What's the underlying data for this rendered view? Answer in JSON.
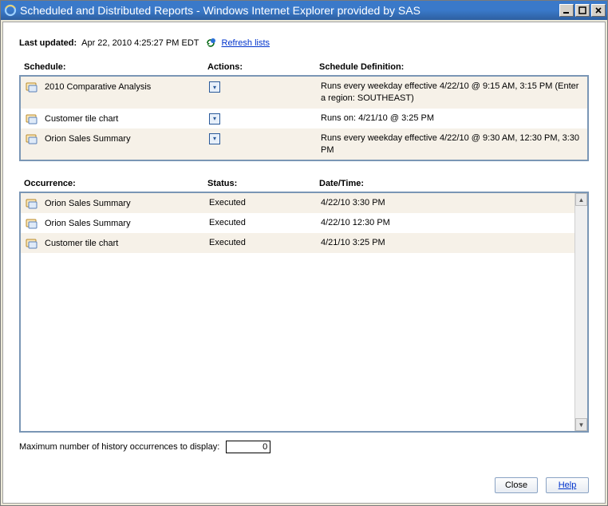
{
  "window": {
    "title": "Scheduled and Distributed Reports - Windows Internet Explorer provided by SAS"
  },
  "lastUpdated": {
    "label": "Last updated:",
    "value": "Apr 22, 2010 4:25:27 PM EDT",
    "refreshLabel": " Refresh lists"
  },
  "scheduleHeaders": {
    "schedule": "Schedule:",
    "actions": "Actions:",
    "definition": "Schedule Definition:"
  },
  "schedules": [
    {
      "name": "2010 Comparative Analysis",
      "definition": "Runs every weekday effective 4/22/10 @ 9:15 AM, 3:15 PM (Enter a region: SOUTHEAST)"
    },
    {
      "name": "Customer tile chart",
      "definition": "Runs on: 4/21/10 @ 3:25 PM"
    },
    {
      "name": "Orion Sales Summary",
      "definition": "Runs every weekday effective 4/22/10 @ 9:30 AM, 12:30 PM, 3:30 PM"
    }
  ],
  "occurrenceHeaders": {
    "occurrence": "Occurrence:",
    "status": "Status:",
    "datetime": "Date/Time:"
  },
  "occurrences": [
    {
      "name": "Orion Sales Summary",
      "status": "Executed",
      "datetime": "4/22/10 3:30 PM"
    },
    {
      "name": "Orion Sales Summary",
      "status": "Executed",
      "datetime": "4/22/10 12:30 PM"
    },
    {
      "name": "Customer tile chart",
      "status": "Executed",
      "datetime": "4/21/10 3:25 PM"
    }
  ],
  "maxHistory": {
    "label": "Maximum number of history occurrences to display:",
    "value": "0"
  },
  "buttons": {
    "close": "Close",
    "help": "Help"
  }
}
